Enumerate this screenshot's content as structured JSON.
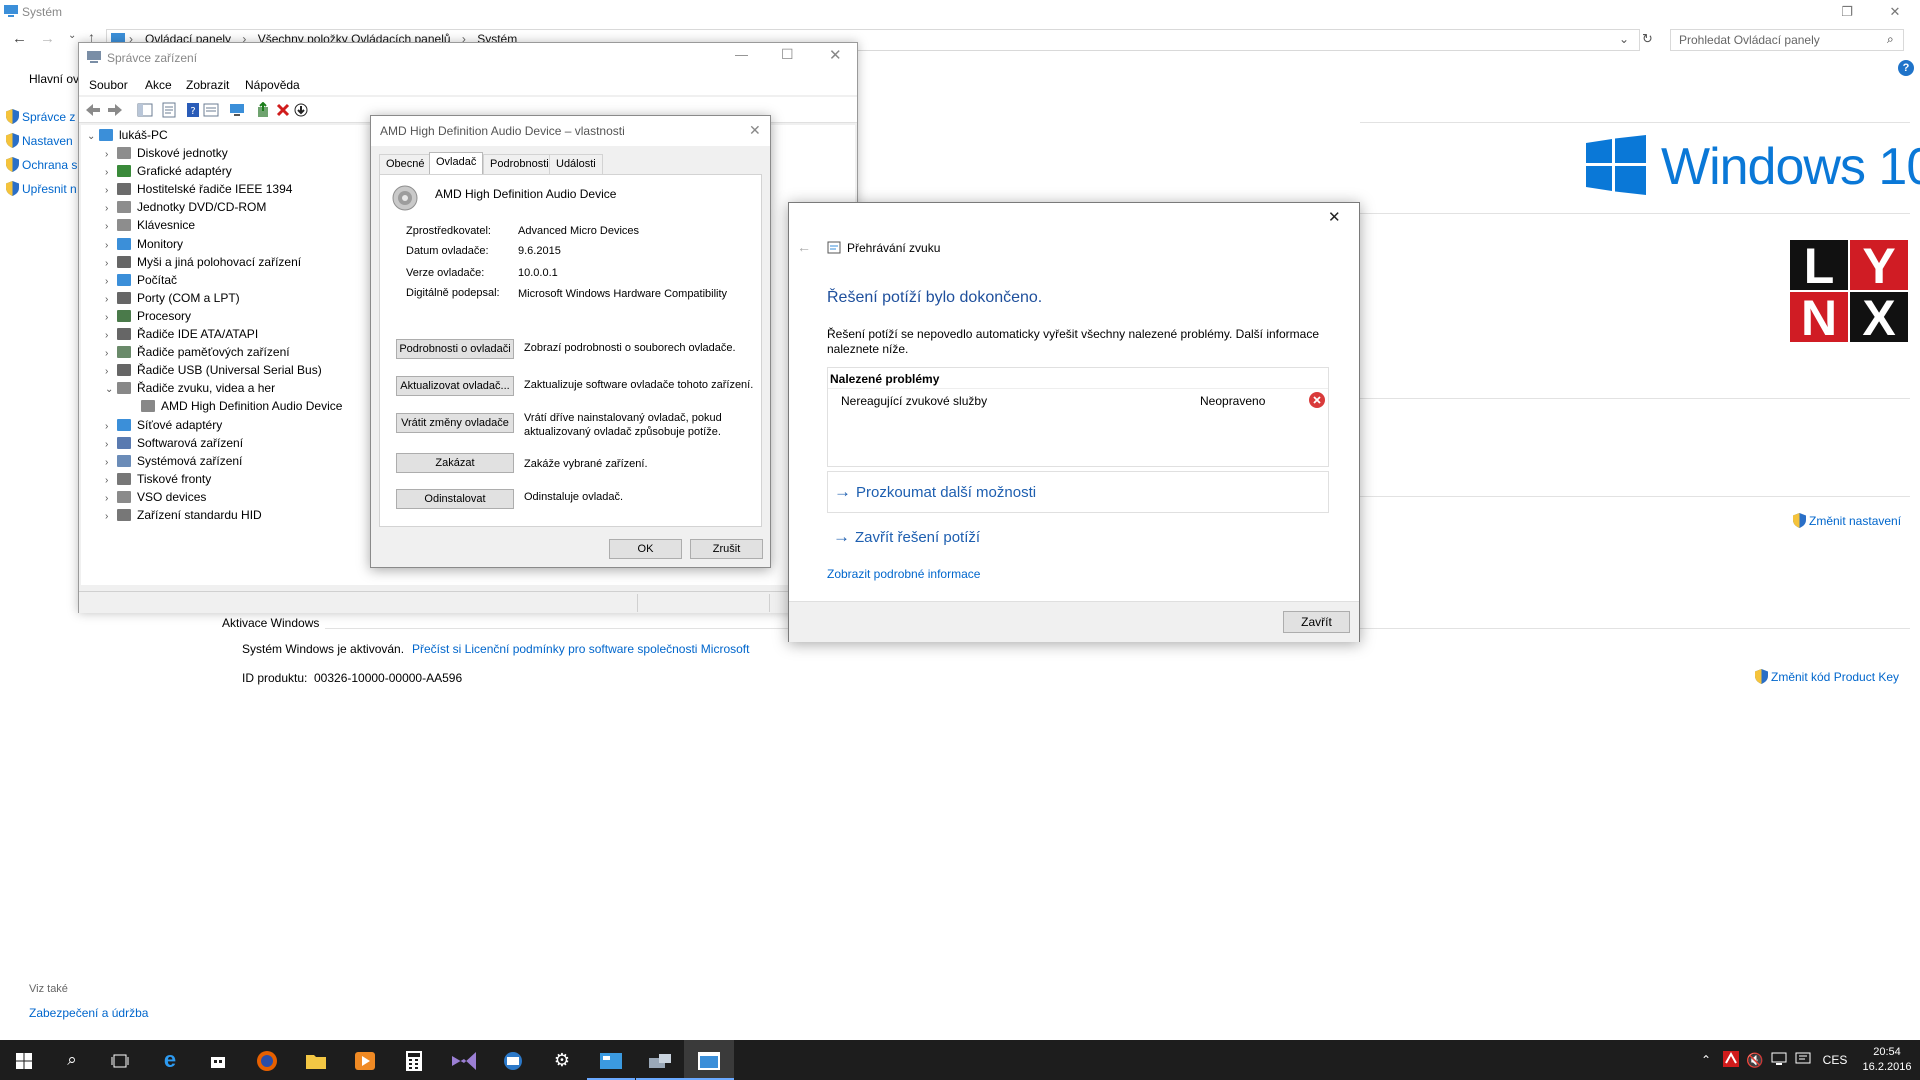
{
  "system": {
    "title": "Systém",
    "address": [
      "Ovládací panely",
      "Všechny položky Ovládacích panelů",
      "Systém"
    ],
    "search_placeholder": "Prohledat Ovládací panely",
    "leftnav": [
      "Hlavní ov",
      "Správce z",
      "Nastaven",
      "Ochrana s",
      "Upřesnit n"
    ],
    "activation_header": "Aktivace Windows",
    "activation_status": "Systém Windows je aktivován.",
    "license_link": "Přečíst si Licenční podmínky pro software společnosti Microsoft",
    "product_id_label": "ID produktu:",
    "product_id": "00326-10000-00000-AA596",
    "change_settings": "Změnit nastavení",
    "change_key": "Změnit kód Product Key",
    "see_also": "Viz také",
    "security": "Zabezpečení a údržba",
    "win10_logo": "Windows 10",
    "lynx_logo": [
      "L",
      "Y",
      "N",
      "X"
    ]
  },
  "devmgr": {
    "title": "Správce zařízení",
    "menu": [
      "Soubor",
      "Akce",
      "Zobrazit",
      "Nápověda"
    ],
    "root": "lukáš-PC",
    "nodes": [
      "Diskové jednotky",
      "Grafické adaptéry",
      "Hostitelské řadiče IEEE 1394",
      "Jednotky DVD/CD-ROM",
      "Klávesnice",
      "Monitory",
      "Myši a jiná polohovací zařízení",
      "Počítač",
      "Porty (COM a LPT)",
      "Procesory",
      "Řadiče IDE ATA/ATAPI",
      "Řadiče paměťových zařízení",
      "Řadiče USB (Universal Serial Bus)",
      "Řadiče zvuku, videa a her",
      "AMD High Definition Audio Device",
      "Síťové adaptéry",
      "Softwarová zařízení",
      "Systémová zařízení",
      "Tiskové fronty",
      "VSO devices",
      "Zařízení standardu HID"
    ]
  },
  "props": {
    "title": "AMD High Definition Audio Device – vlastnosti",
    "tabs": [
      "Obecné",
      "Ovladač",
      "Podrobnosti",
      "Události"
    ],
    "device": "AMD High Definition Audio Device",
    "rows": [
      {
        "k": "Zprostředkovatel:",
        "v": "Advanced Micro Devices"
      },
      {
        "k": "Datum ovladače:",
        "v": "9.6.2015"
      },
      {
        "k": "Verze ovladače:",
        "v": "10.0.0.1"
      },
      {
        "k": "Digitálně podepsal:",
        "v": "Microsoft Windows Hardware Compatibility"
      }
    ],
    "actions": [
      {
        "btn": "Podrobnosti o ovladači",
        "desc": "Zobrazí podrobnosti o souborech ovladače."
      },
      {
        "btn": "Aktualizovat ovladač...",
        "desc": "Zaktualizuje software ovladače tohoto zařízení."
      },
      {
        "btn": "Vrátit změny ovladače",
        "desc": "Vrátí dříve nainstalovaný ovladač, pokud aktualizovaný ovladač způsobuje potíže."
      },
      {
        "btn": "Zakázat",
        "desc": "Zakáže vybrané zařízení."
      },
      {
        "btn": "Odinstalovat",
        "desc": "Odinstaluje ovladač."
      }
    ],
    "ok": "OK",
    "cancel": "Zrušit"
  },
  "trbl": {
    "title": "Přehrávání zvuku",
    "heading": "Řešení potíží bylo dokončeno.",
    "message": "Řešení potíží se nepovedlo automaticky vyřešit všechny nalezené problémy. Další informace naleznete níže.",
    "found_header": "Nalezené problémy",
    "problem": "Nereagující zvukové služby",
    "problem_status": "Neopraveno",
    "explore": "Prozkoumat další možnosti",
    "close_trbl": "Zavřít řešení potíží",
    "details": "Zobrazit podrobné informace",
    "close": "Zavřít"
  },
  "taskbar": {
    "lang": "CES",
    "time": "20:54",
    "date": "16.2.2016"
  }
}
